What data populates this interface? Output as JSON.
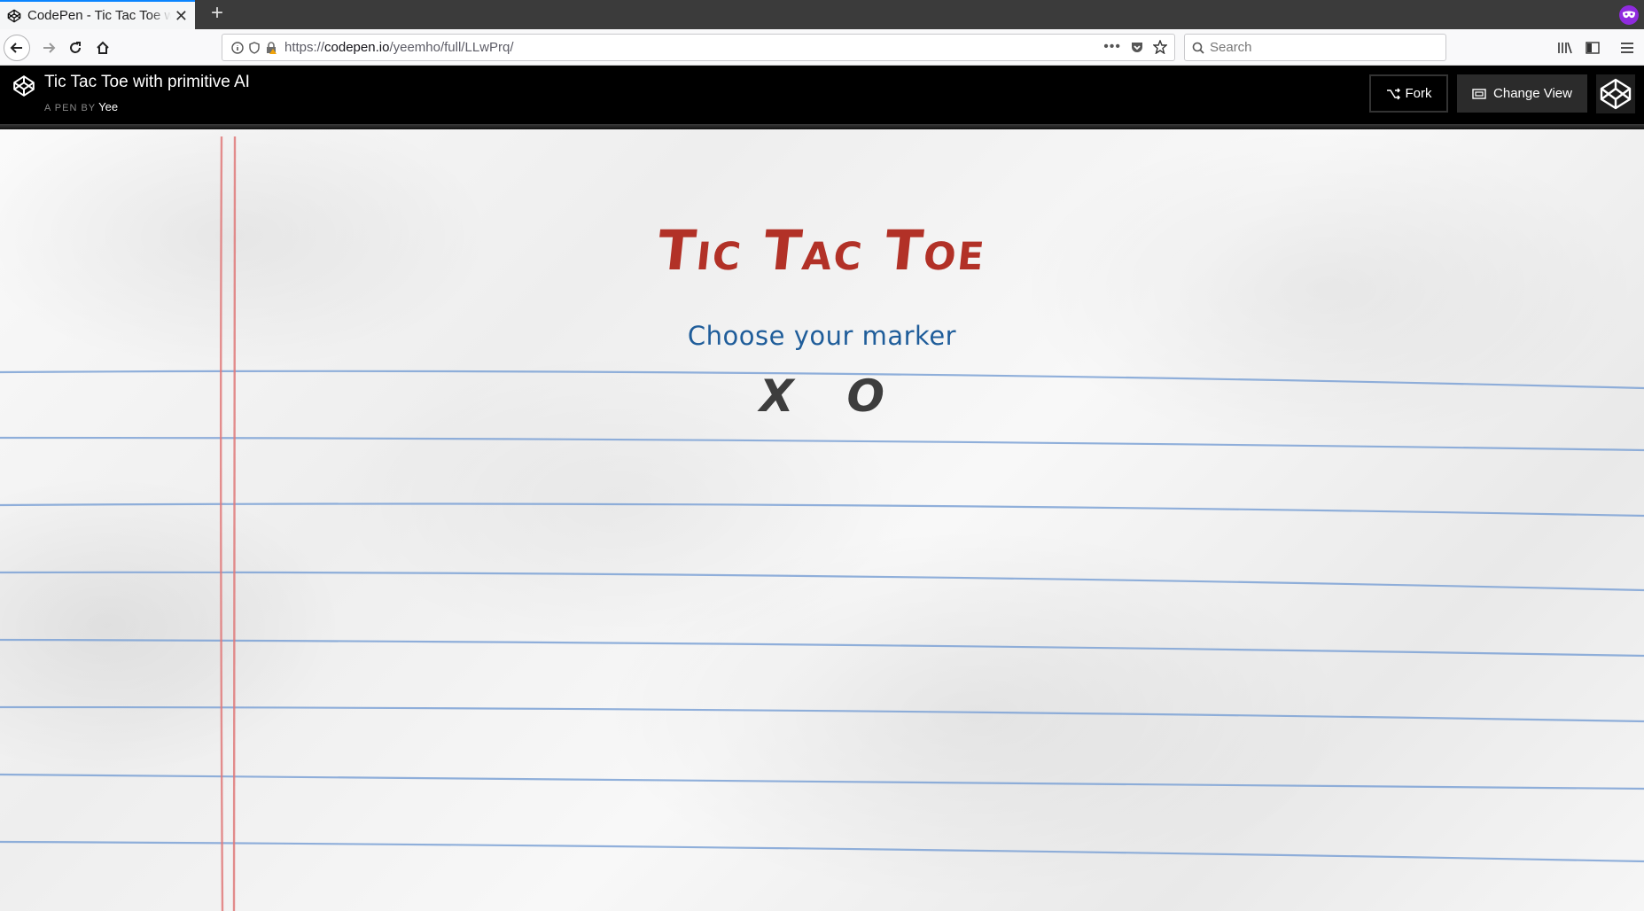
{
  "browser": {
    "tab": {
      "title": "CodePen - Tic Tac Toe with primitive AI"
    },
    "url": {
      "prefix": "https://",
      "domain": "codepen.io",
      "path": "/yeemho/full/LLwPrq/"
    },
    "search": {
      "placeholder": "Search"
    }
  },
  "header": {
    "title": "Tic Tac Toe with primitive AI",
    "by_label": "A PEN BY",
    "author": "Yee",
    "fork_label": "Fork",
    "change_view_label": "Change View"
  },
  "game": {
    "title": "Tic Tac Toe",
    "subtitle": "Choose your marker",
    "markers": [
      "X",
      "O"
    ]
  },
  "colors": {
    "title_red": "#b23127",
    "subtitle_blue": "#1f5d9a",
    "marker_gray": "#3d3d3d",
    "rule_blue": "#7ea3d6",
    "margin_red": "#e07a7a"
  }
}
